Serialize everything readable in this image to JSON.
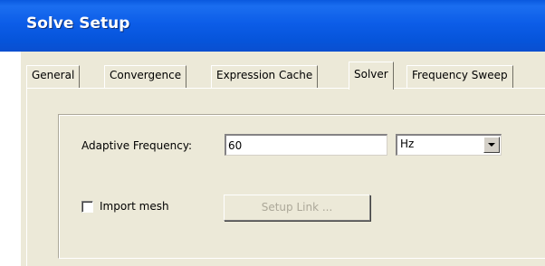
{
  "window": {
    "title": "Solve Setup"
  },
  "tabs": [
    {
      "label": "General",
      "active": false
    },
    {
      "label": "Convergence",
      "active": false
    },
    {
      "label": "Expression Cache",
      "active": false
    },
    {
      "label": "Solver",
      "active": true
    },
    {
      "label": "Frequency Sweep",
      "active": false
    }
  ],
  "solver": {
    "adaptive_frequency_label": "Adaptive Frequency:",
    "adaptive_frequency_value": "60",
    "frequency_unit": "Hz",
    "import_mesh_label": "Import mesh",
    "import_mesh_checked": false,
    "setup_link_label": "Setup Link ...",
    "setup_link_enabled": false
  },
  "colors": {
    "titlebar": "#0a5ce6",
    "dialog_background": "#ece9d8",
    "disabled_text": "#aca899"
  }
}
